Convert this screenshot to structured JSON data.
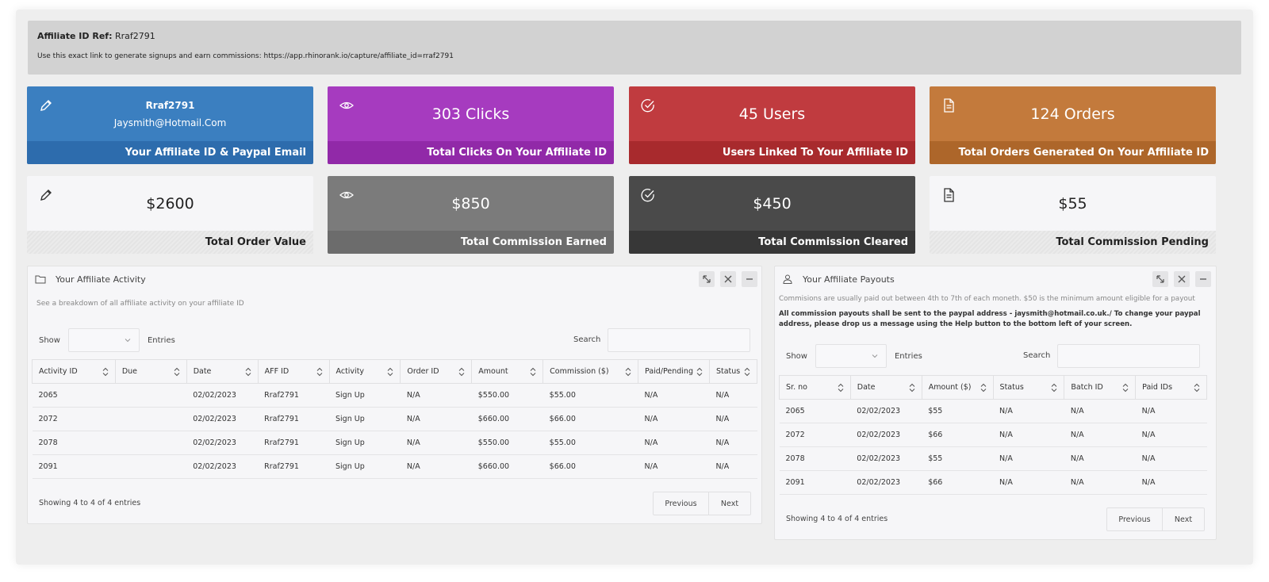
{
  "ref": {
    "label": "Affiliate ID Ref:",
    "value": "Rraf2791",
    "link_text": "Use this exact link to generate signups and earn commissions: https://app.rhinorank.io/capture/affiliate_id=rraf2791"
  },
  "cards": [
    {
      "uid": "Rraf2791",
      "email": "Jaysmith@Hotmail.Com",
      "caption": "Your Affiliate ID & Paypal Email",
      "icon": "pencil-icon",
      "color": "#3b7fc0"
    },
    {
      "value": "303 Clicks",
      "caption": "Total Clicks On Your Affiliate ID",
      "icon": "eye-icon",
      "color": "#a63bbf"
    },
    {
      "value": "45 Users",
      "caption": "Users Linked To Your Affiliate ID",
      "icon": "check-circle-icon",
      "color": "#c03b3f"
    },
    {
      "value": "124 Orders",
      "caption": "Total Orders Generated On Your Affiliate ID",
      "icon": "document-icon",
      "color": "#c37a3c"
    },
    {
      "value": "$2600",
      "caption": "Total Order Value",
      "icon": "pencil-icon",
      "color": "#f6f6f8"
    },
    {
      "value": "$850",
      "caption": "Total Commission Earned",
      "icon": "eye-icon",
      "color": "#7b7b7b"
    },
    {
      "value": "$450",
      "caption": "Total Commission Cleared",
      "icon": "check-circle-icon",
      "color": "#4a4a4a"
    },
    {
      "value": "$55",
      "caption": "Total Commission Pending",
      "icon": "document-icon",
      "color": "#f6f6f8"
    }
  ],
  "activity": {
    "title": "Your Affiliate Activity",
    "description": "See a breakdown of all affiliate activity on your affiliate ID",
    "show_label": "Show",
    "entries_label": "Entries",
    "search_label": "Search",
    "columns": [
      "Activity ID",
      "Due",
      "Date",
      "AFF ID",
      "Activity",
      "Order ID",
      "Amount",
      "Commission ($)",
      "Paid/Pending",
      "Status"
    ],
    "rows": [
      [
        "2065",
        "",
        "02/02/2023",
        "Rraf2791",
        "Sign Up",
        "N/A",
        "$550.00",
        "$55.00",
        "N/A",
        "N/A"
      ],
      [
        "2072",
        "",
        "02/02/2023",
        "Rraf2791",
        "Sign Up",
        "N/A",
        "$660.00",
        "$66.00",
        "N/A",
        "N/A"
      ],
      [
        "2078",
        "",
        "02/02/2023",
        "Rraf2791",
        "Sign Up",
        "N/A",
        "$550.00",
        "$55.00",
        "N/A",
        "N/A"
      ],
      [
        "2091",
        "",
        "02/02/2023",
        "Rraf2791",
        "Sign Up",
        "N/A",
        "$660.00",
        "$66.00",
        "N/A",
        "N/A"
      ]
    ],
    "info": "Showing 4 to 4 of 4 entries",
    "prev": "Previous",
    "next": "Next"
  },
  "payouts": {
    "title": "Your Affiliate Payouts",
    "note": "Commisions are usually paid out between 4th to 7th of each moneth. $50 is the minimum amount eligible for a payout",
    "note_bold": "All commission payouts shall be sent to the paypal address - jaysmith@hotmail.co.uk./ To change your paypal address, please drop us a message using the Help button to the bottom left of your screen.",
    "show_label": "Show",
    "entries_label": "Entries",
    "search_label": "Search",
    "columns": [
      "Sr. no",
      "Date",
      "Amount ($)",
      "Status",
      "Batch ID",
      "Paid IDs"
    ],
    "rows": [
      [
        "2065",
        "02/02/2023",
        "$55",
        "N/A",
        "N/A",
        "N/A"
      ],
      [
        "2072",
        "02/02/2023",
        "$66",
        "N/A",
        "N/A",
        "N/A"
      ],
      [
        "2078",
        "02/02/2023",
        "$55",
        "N/A",
        "N/A",
        "N/A"
      ],
      [
        "2091",
        "02/02/2023",
        "$66",
        "N/A",
        "N/A",
        "N/A"
      ]
    ],
    "info": "Showing 4 to 4 of 4 entries",
    "prev": "Previous",
    "next": "Next"
  }
}
